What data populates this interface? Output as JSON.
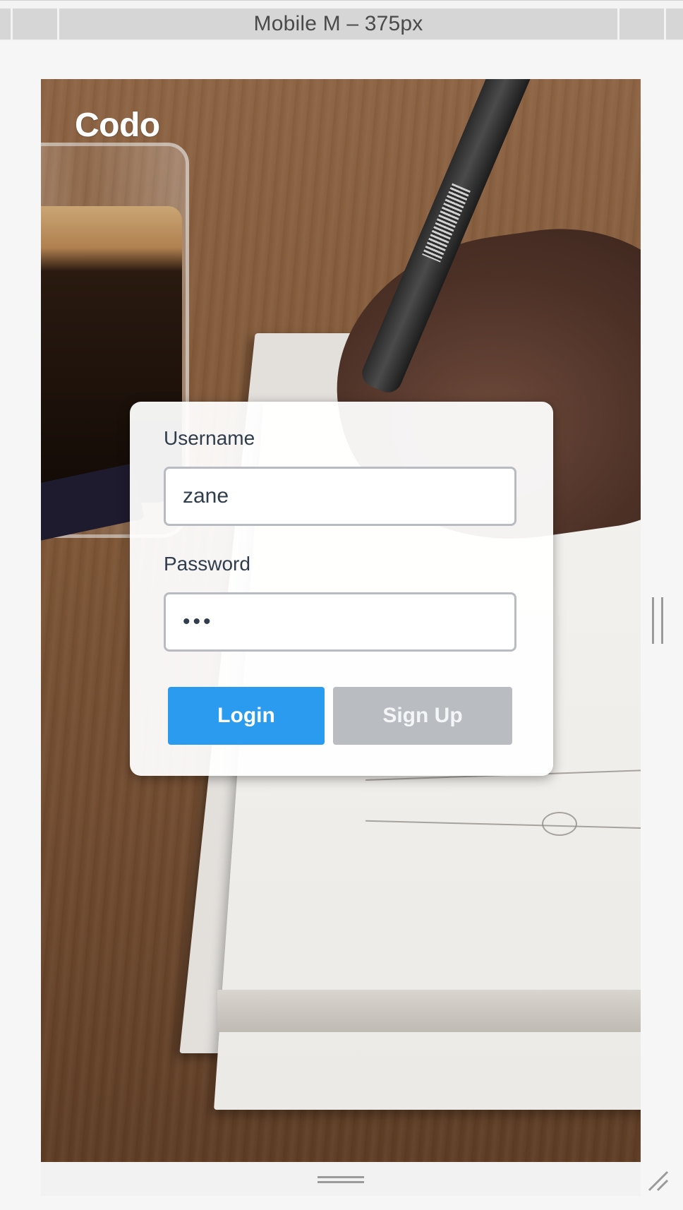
{
  "devtools": {
    "device_label": "Mobile M – 375px"
  },
  "app": {
    "logo": "Codo"
  },
  "login_form": {
    "username_label": "Username",
    "username_value": "zane",
    "password_label": "Password",
    "password_value": "•••",
    "login_button": "Login",
    "signup_button": "Sign Up"
  },
  "colors": {
    "primary_button": "#2b9bf0",
    "secondary_button": "#b9bdc1",
    "label_text": "#2f3d4c"
  }
}
